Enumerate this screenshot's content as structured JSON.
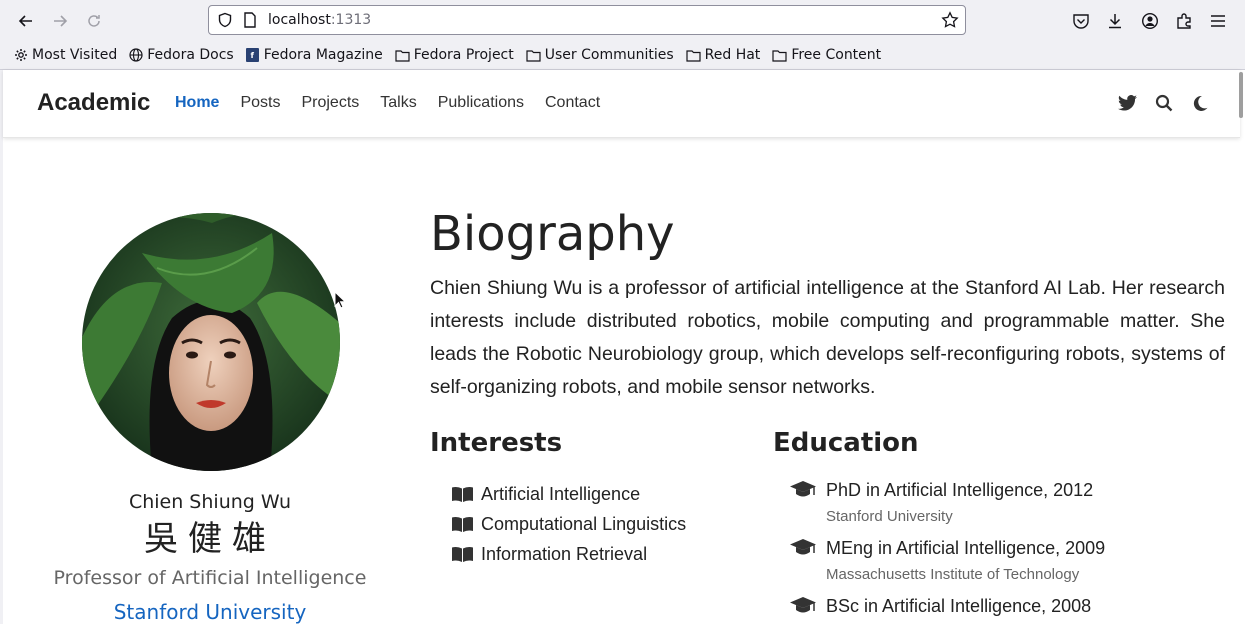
{
  "browser": {
    "url_host": "localhost",
    "url_port": ":1313",
    "bookmarks": [
      {
        "label": "Most Visited",
        "icon": "gear-icon"
      },
      {
        "label": "Fedora Docs",
        "icon": "globe-icon"
      },
      {
        "label": "Fedora Magazine",
        "icon": "fedora-magazine-icon"
      },
      {
        "label": "Fedora Project",
        "icon": "folder-icon"
      },
      {
        "label": "User Communities",
        "icon": "folder-icon"
      },
      {
        "label": "Red Hat",
        "icon": "folder-icon"
      },
      {
        "label": "Free Content",
        "icon": "folder-icon"
      }
    ]
  },
  "site": {
    "brand": "Academic",
    "menu": [
      "Home",
      "Posts",
      "Projects",
      "Talks",
      "Publications",
      "Contact"
    ],
    "active_menu": "Home",
    "header_icons": [
      "twitter-icon",
      "search-icon",
      "moon-icon"
    ]
  },
  "profile": {
    "name": "Chien Shiung Wu",
    "chinese_name": "吳健雄",
    "role": "Professor of Artificial Intelligence",
    "organization": "Stanford University"
  },
  "biography": {
    "title": "Biography",
    "text": "Chien Shiung Wu is a professor of artificial intelligence at the Stanford AI Lab. Her research interests include distributed robotics, mobile computing and programmable matter. She leads the Robotic Neurobiology group, which develops self-reconfiguring robots, systems of self-organizing robots, and mobile sensor networks."
  },
  "interests": {
    "title": "Interests",
    "items": [
      "Artificial Intelligence",
      "Computational Linguistics",
      "Information Retrieval"
    ]
  },
  "education": {
    "title": "Education",
    "items": [
      {
        "degree": "PhD in Artificial Intelligence, 2012",
        "institution": "Stanford University"
      },
      {
        "degree": "MEng in Artificial Intelligence, 2009",
        "institution": "Massachusetts Institute of Technology"
      },
      {
        "degree": "BSc in Artificial Intelligence, 2008",
        "institution": ""
      }
    ]
  },
  "colors": {
    "accent": "#1565c0",
    "text": "#222222",
    "muted": "#666666"
  }
}
